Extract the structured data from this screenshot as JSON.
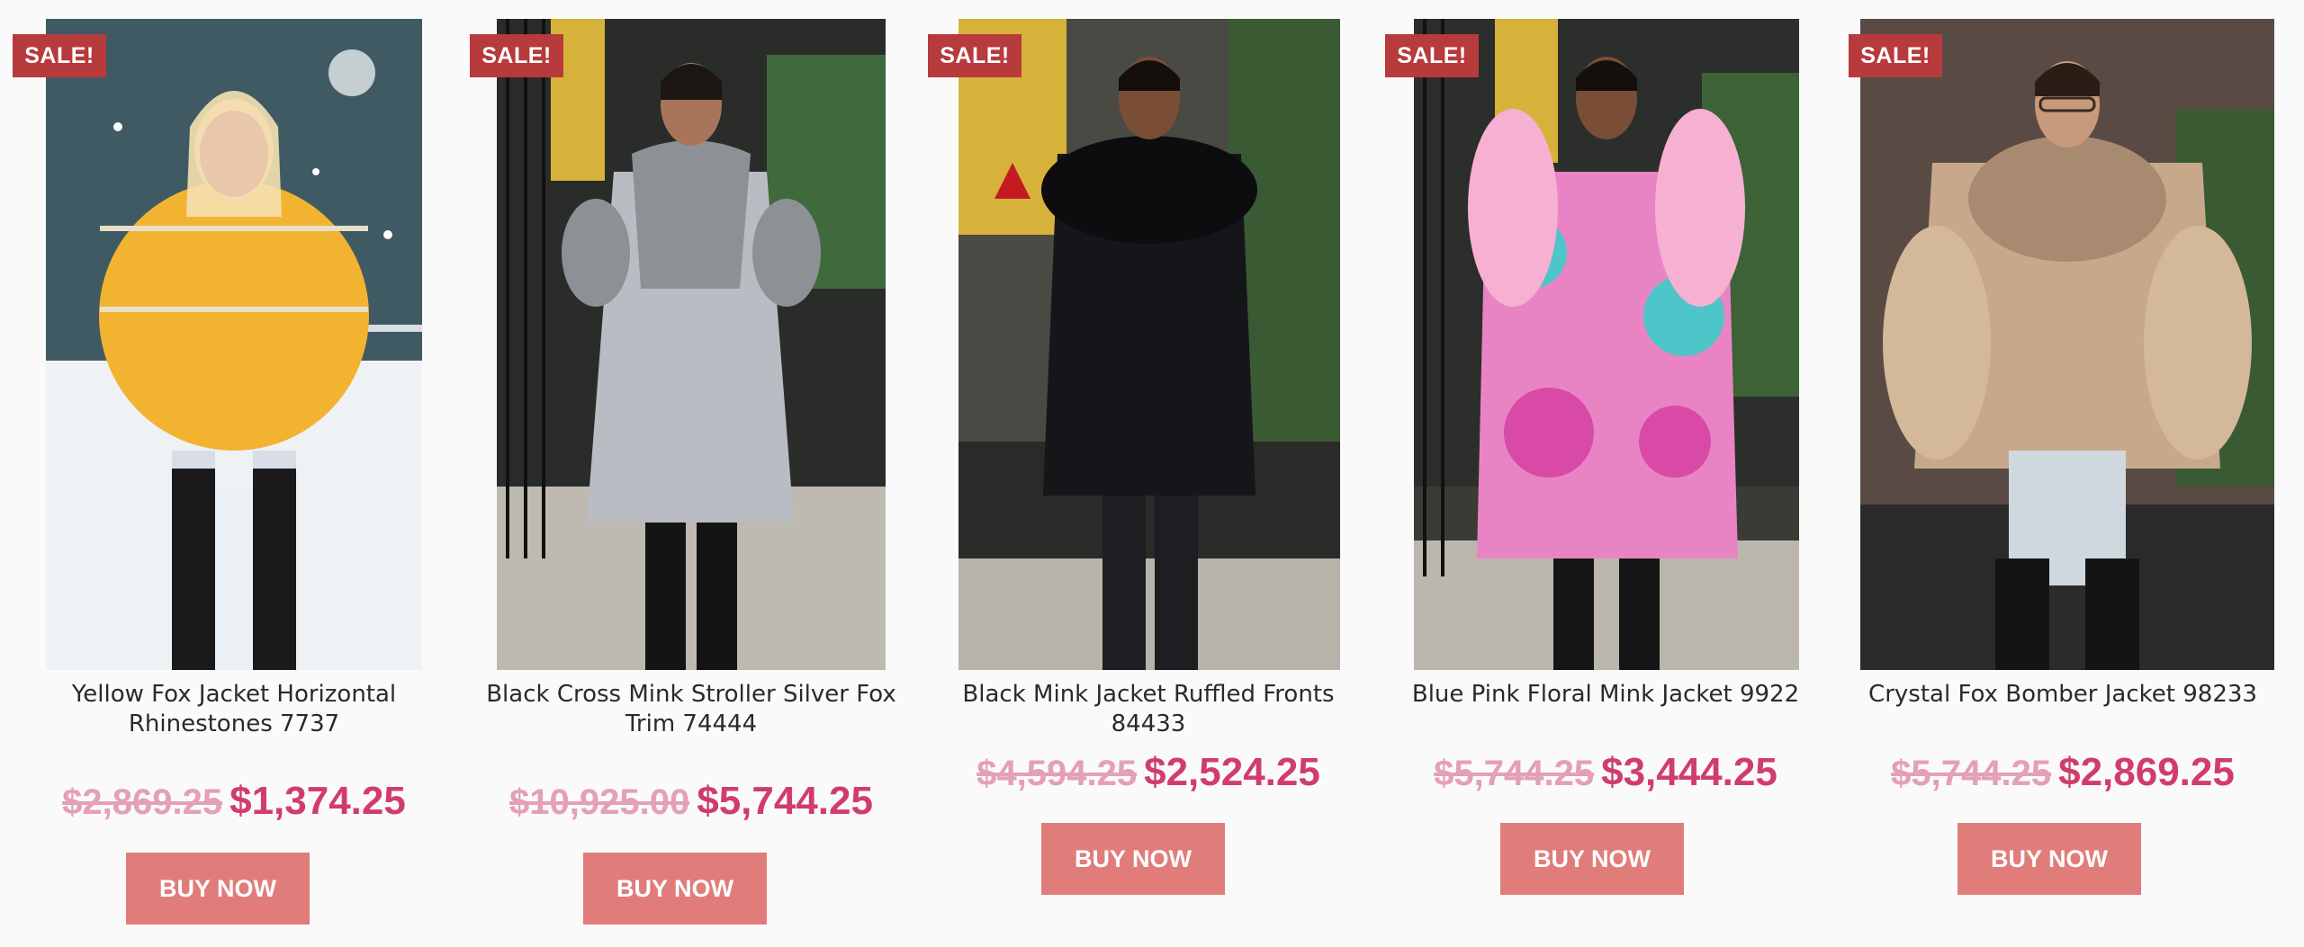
{
  "colors": {
    "sale_badge": "#b73a3c",
    "old_price": "#e4a0b5",
    "new_price": "#d13d6b",
    "buy_button": "#e07d7b"
  },
  "products": [
    {
      "badge": "SALE!",
      "title": "Yellow Fox Jacket Horizontal Rhinestones 7737",
      "old_price": "$2,869.25",
      "new_price": "$1,374.25",
      "button": "BUY NOW",
      "coat_color": "#f2b331",
      "image": "model-in-yellow-fox-jacket"
    },
    {
      "badge": "SALE!",
      "title": "Black Cross Mink Stroller Silver Fox Trim 74444",
      "old_price": "$10,925.00",
      "new_price": "$5,744.25",
      "button": "BUY NOW",
      "coat_color": "#b9bcc2",
      "image": "model-in-grey-mink-stroller"
    },
    {
      "badge": "SALE!",
      "title": "Black Mink Jacket Ruffled Fronts 84433",
      "old_price": "$4,594.25",
      "new_price": "$2,524.25",
      "button": "BUY NOW",
      "coat_color": "#15161a",
      "image": "model-in-black-mink-jacket"
    },
    {
      "badge": "SALE!",
      "title": "Blue Pink Floral Mink Jacket 9922",
      "old_price": "$5,744.25",
      "new_price": "$3,444.25",
      "button": "BUY NOW",
      "coat_color": "#e984c4",
      "image": "model-in-floral-mink-jacket"
    },
    {
      "badge": "SALE!",
      "title": "Crystal Fox Bomber Jacket 98233",
      "old_price": "$5,744.25",
      "new_price": "$2,869.25",
      "button": "BUY NOW",
      "coat_color": "#c7a88a",
      "image": "model-in-crystal-fox-bomber"
    }
  ]
}
